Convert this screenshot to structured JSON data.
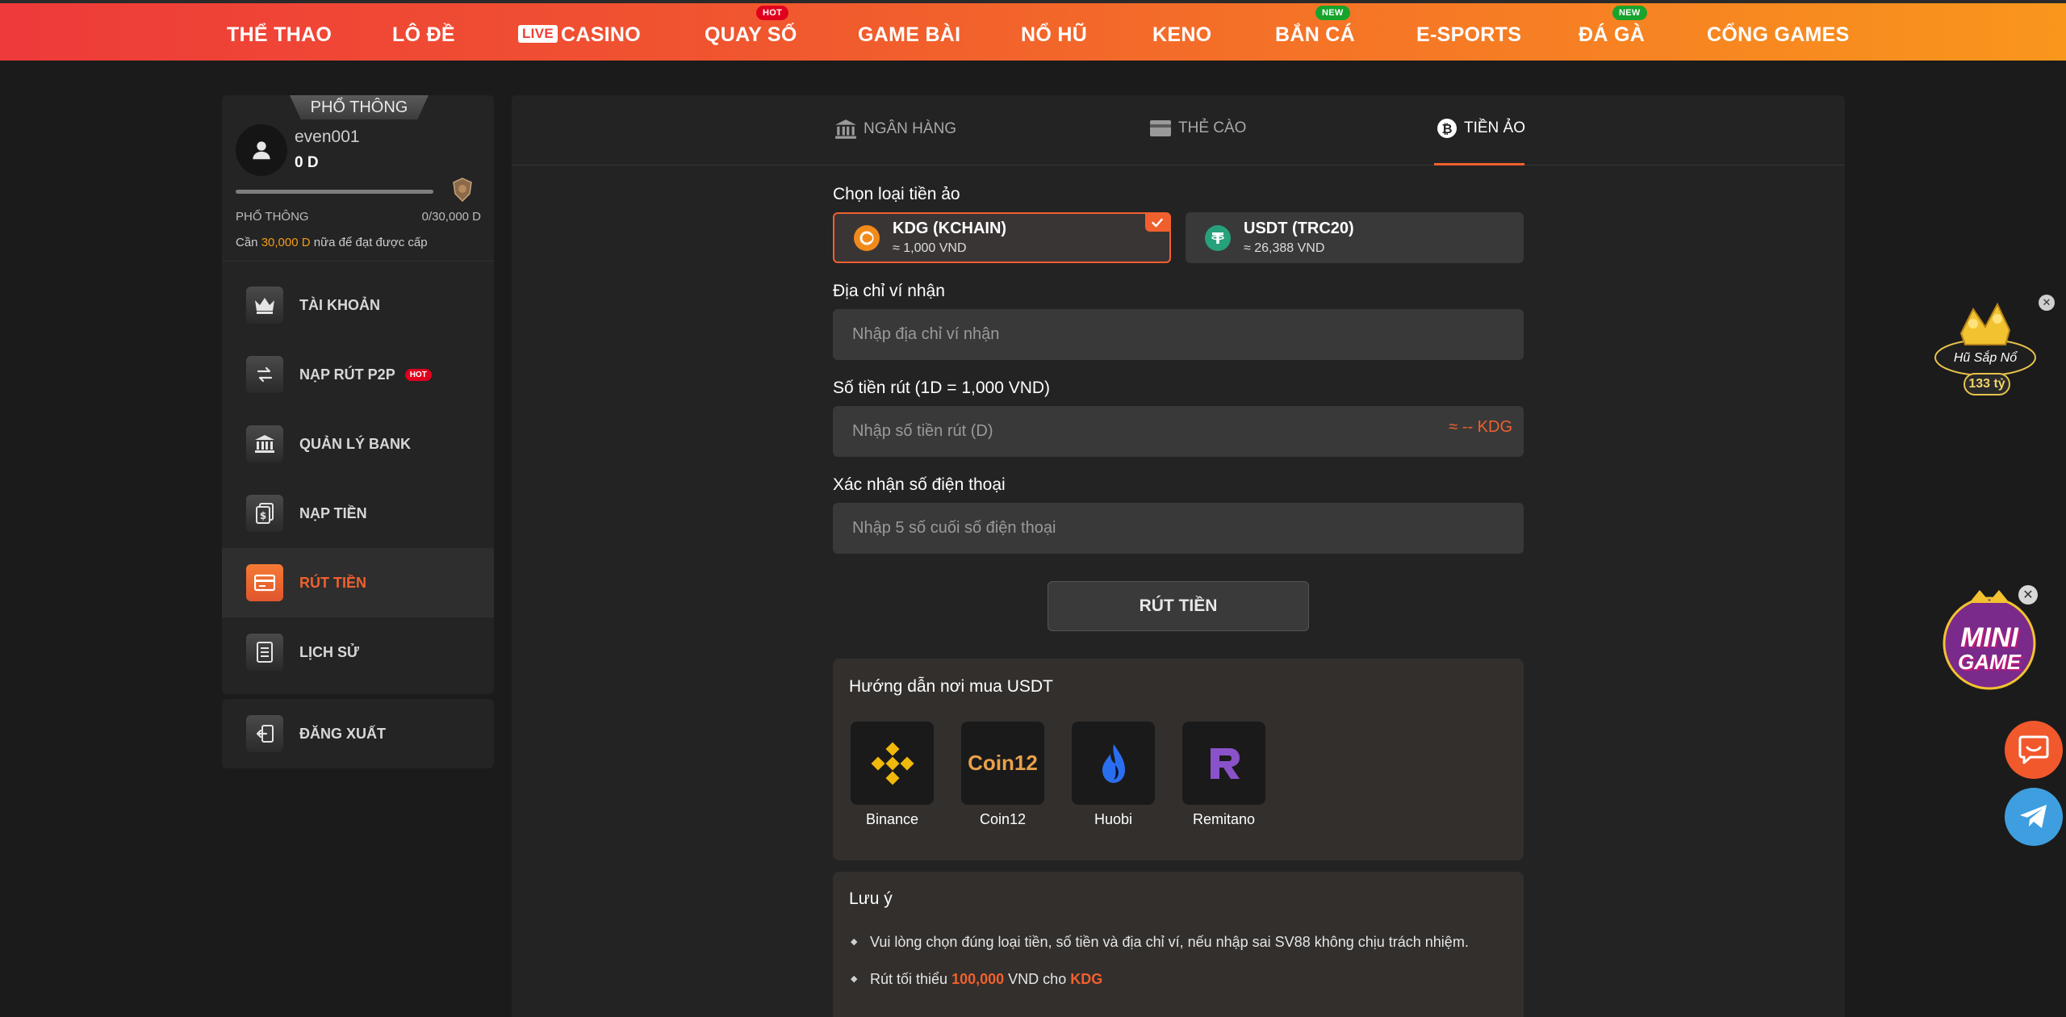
{
  "nav": {
    "items": [
      {
        "label": "THỂ THAO"
      },
      {
        "label": "LÔ ĐỀ"
      },
      {
        "label": "CASINO",
        "live": "LIVE"
      },
      {
        "label": "QUAY SỐ",
        "tag": "HOT"
      },
      {
        "label": "GAME BÀI"
      },
      {
        "label": "NỔ HŨ"
      },
      {
        "label": "KENO"
      },
      {
        "label": "BẮN CÁ",
        "tag": "NEW"
      },
      {
        "label": "E-SPORTS"
      },
      {
        "label": "ĐÁ GÀ",
        "tag": "NEW"
      },
      {
        "label": "CỔNG GAMES"
      }
    ]
  },
  "sidebar": {
    "tier_banner": "PHỔ THÔNG",
    "username": "even001",
    "balance": "0 D",
    "tier_label": "PHỔ THÔNG",
    "tier_progress": "0/30,000 D",
    "tier_progress_fraction": 0,
    "need_prefix": "Cần",
    "need_amount": "30,000 D",
    "need_suffix": "nữa để đạt được cấp",
    "menu": [
      {
        "label": "TÀI KHOẢN",
        "icon": "crown-icon"
      },
      {
        "label": "NẠP RÚT P2P",
        "icon": "transfer-icon",
        "badge": "HOT"
      },
      {
        "label": "QUẢN LÝ BANK",
        "icon": "bank-icon"
      },
      {
        "label": "NẠP TIỀN",
        "icon": "deposit-icon"
      },
      {
        "label": "RÚT TIỀN",
        "icon": "withdraw-icon",
        "active": true
      },
      {
        "label": "LỊCH SỬ",
        "icon": "history-icon"
      }
    ],
    "logout": "ĐĂNG XUẤT"
  },
  "tabs": [
    {
      "label": "NGÂN HÀNG",
      "icon": "bank-icon"
    },
    {
      "label": "THẺ CÀO",
      "icon": "card-icon"
    },
    {
      "label": "TIỀN ẢO",
      "icon": "bitcoin-icon",
      "active": true
    }
  ],
  "form": {
    "coin_label": "Chọn loại tiền ảo",
    "coins": [
      {
        "name": "KDG (KCHAIN)",
        "rate": "≈ 1,000 VND",
        "selected": true,
        "color": "#f28a1a"
      },
      {
        "name": "USDT (TRC20)",
        "rate": "≈ 26,388 VND",
        "selected": false,
        "color": "#26a17b"
      }
    ],
    "address_label": "Địa chỉ ví nhận",
    "address_placeholder": "Nhập địa chỉ ví nhận",
    "amount_label": "Số tiền rút (1D = 1,000 VND)",
    "amount_placeholder": "Nhập số tiền rút (D)",
    "amount_suffix": "≈ -- KDG",
    "phone_label": "Xác nhận số điện thoại",
    "phone_placeholder": "Nhập 5 số cuối số điện thoại",
    "submit": "RÚT TIỀN"
  },
  "guide": {
    "title": "Hướng dẫn nơi mua USDT",
    "exchanges": [
      {
        "name": "Binance",
        "icon": "binance-icon"
      },
      {
        "name": "Coin12",
        "icon": "coin12-icon",
        "logo_text": "Coin12"
      },
      {
        "name": "Huobi",
        "icon": "huobi-icon"
      },
      {
        "name": "Remitano",
        "icon": "remitano-icon"
      }
    ]
  },
  "note": {
    "title": "Lưu ý",
    "item1": "Vui lòng chọn đúng loại tiền, số tiền và địa chỉ ví, nếu nhập sai SV88 không chịu trách nhiệm.",
    "item2_prefix": "Rút tối thiểu",
    "item2_amount": "100,000",
    "item2_mid": "VND cho",
    "item2_coin": "KDG"
  },
  "floats": {
    "jackpot_label": "Hũ Sắp Nổ",
    "jackpot_amount": "133 tỷ",
    "mini_line1": "MINI",
    "mini_line2": "GAME"
  },
  "colors": {
    "accent": "#f0602e",
    "highlight_amount": "#f39c12"
  }
}
